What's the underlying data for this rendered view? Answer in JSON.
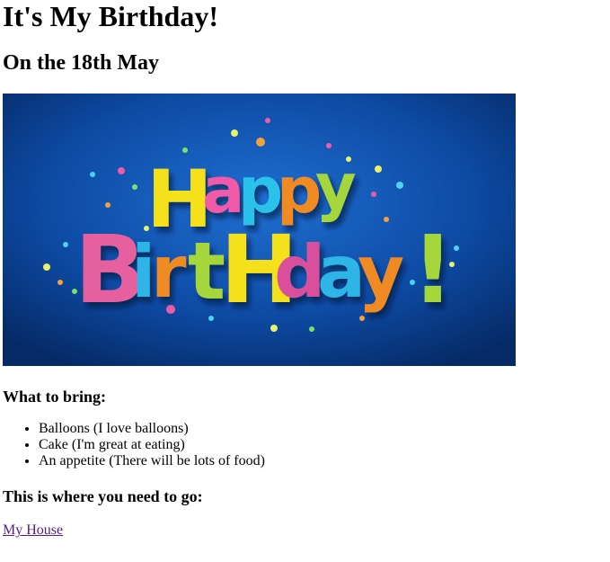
{
  "page": {
    "title": "It's My Birthday!",
    "subtitle": "On the 18th May"
  },
  "banner": {
    "line1": "Happy",
    "line2": "BirtHday!",
    "background": "#0b3f8c"
  },
  "bring": {
    "heading": "What to bring:",
    "items": [
      "Balloons (I love balloons)",
      "Cake (I'm great at eating)",
      "An appetite (There will be lots of food)"
    ]
  },
  "location": {
    "heading": "This is where you need to go:",
    "link_text": "My House"
  }
}
